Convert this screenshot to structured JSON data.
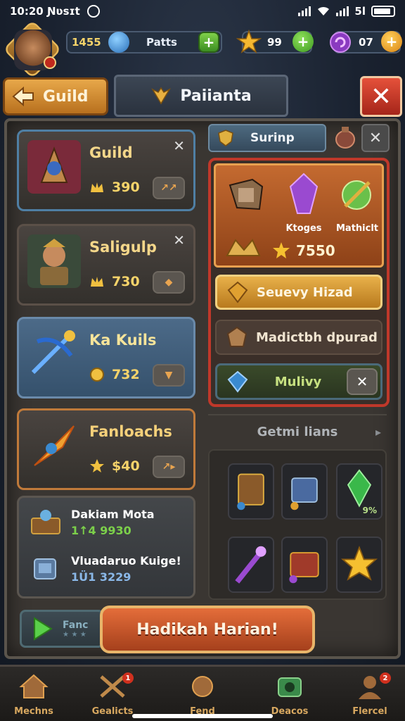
{
  "status_bar": {
    "time": "10:20 Ɲʋsɪt",
    "signal": "5l"
  },
  "resources": {
    "gems": {
      "value": "1455",
      "label": "Patts"
    },
    "stars": {
      "value": "99"
    },
    "orbs": {
      "value": "07"
    }
  },
  "header": {
    "back_label": "Guild",
    "title": "Paiianta",
    "close_symbol": "✕"
  },
  "guild_cards": [
    {
      "name": "Guild",
      "cost": "390",
      "action": "↗↗",
      "has_close": true
    },
    {
      "name": "Saligulp",
      "cost": "730",
      "action": "◆",
      "has_close": true
    },
    {
      "name": "Ka Kuils",
      "cost": "732",
      "action": "▼",
      "has_close": false
    },
    {
      "name": "Fanloachs",
      "cost": "$40",
      "action": "↗▸",
      "has_close": false
    }
  ],
  "info_card": {
    "row1_title": "Dakiam Mota",
    "row1_value": "1↑4 9930",
    "row2_title": "Vluadaruo Kuige!",
    "row2_value": "1Ü1 3229"
  },
  "small_card": {
    "label": "Fanc",
    "dots": "★ ★ ★"
  },
  "cta_button": "Hadikah Harian!",
  "right_panel": {
    "tab_label": "Surinp",
    "close_symbol": "✕",
    "shop_items": [
      {
        "label": ""
      },
      {
        "label": "Ktoges"
      },
      {
        "label": "Mathiclt"
      }
    ],
    "shop_price": "7550",
    "btn_1": "Seuevy Hizad",
    "btn_2": "Madictbh dpurad",
    "btn_3": "Mulivy",
    "btn_3_close": "✕",
    "section_title": "Getmi lians",
    "section_chevron": "▸",
    "grid_tag": "9%"
  },
  "bottom_nav": [
    {
      "label": "Mechns",
      "badge": ""
    },
    {
      "label": "Gealicts",
      "badge": "1"
    },
    {
      "label": "Fend",
      "badge": ""
    },
    {
      "label": "Deacos",
      "badge": ""
    },
    {
      "label": "Flercel",
      "badge": "2"
    }
  ],
  "colors": {
    "gold": "#f5d36a",
    "accent_red": "#c0382a",
    "accent_orange": "#e46d3a",
    "panel": "#3a3632",
    "green": "#7cd04a"
  }
}
